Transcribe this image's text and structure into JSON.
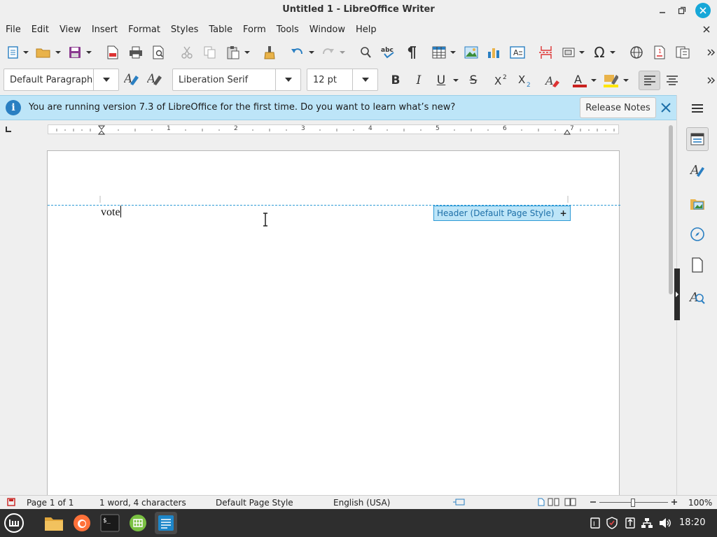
{
  "window": {
    "title": "Untitled 1 - LibreOffice Writer"
  },
  "menu": [
    "File",
    "Edit",
    "View",
    "Insert",
    "Format",
    "Styles",
    "Table",
    "Form",
    "Tools",
    "Window",
    "Help"
  ],
  "formatting": {
    "paragraph_style": "Default Paragraph",
    "font_name": "Liberation Serif",
    "font_size": "12 pt",
    "bold": "B",
    "italic": "I",
    "underline": "U",
    "strike": "S"
  },
  "infobar": {
    "message": "You are running version 7.3 of LibreOffice for the first time. Do you want to learn what’s new?",
    "button": "Release Notes"
  },
  "ruler": {
    "labels": [
      "1",
      "2",
      "3",
      "4",
      "5",
      "6",
      "7"
    ]
  },
  "document": {
    "text": "vote",
    "header_tag": "Header (Default Page Style)",
    "header_tag_plus": "+"
  },
  "status": {
    "page": "Page 1 of 1",
    "words": "1 word, 4 characters",
    "page_style": "Default Page Style",
    "language": "English (USA)",
    "zoom": "100%"
  },
  "taskbar": {
    "clock": "18:20"
  },
  "colors": {
    "accent": "#16a7d8",
    "infobar": "#bde5f8",
    "header_line": "#2d9ad6"
  }
}
